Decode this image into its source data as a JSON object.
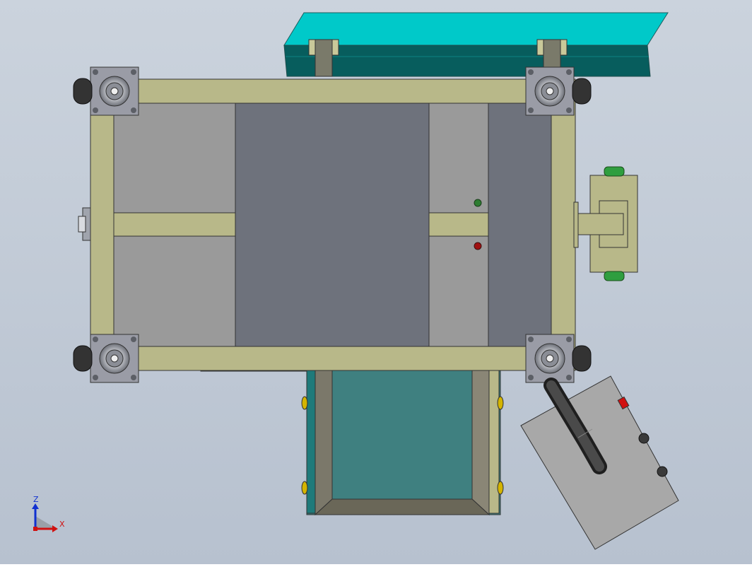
{
  "triad": {
    "z_label": "Z",
    "x_label": "X"
  },
  "colors": {
    "background_top": "#c9d1dc",
    "background_bottom": "#b9c3d0",
    "frame": "#b8b889",
    "panel_light": "#9a9a9a",
    "panel_dark": "#6e727c",
    "hopper_teal": "#3f8080",
    "chute_teal": "#00c9c9",
    "control_box": "#a8a8a8",
    "handle": "#2e2e2e",
    "indicator_green": "#2e7d32",
    "indicator_red": "#a01010"
  }
}
